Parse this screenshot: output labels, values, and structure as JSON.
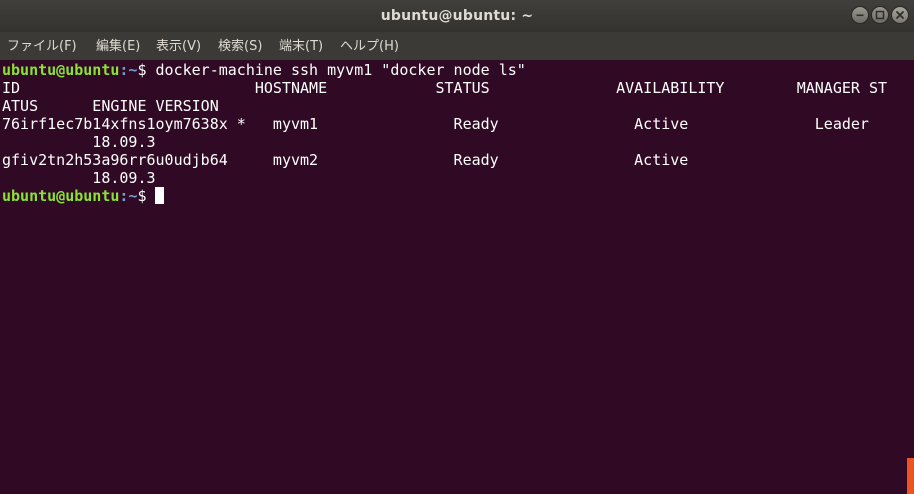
{
  "window": {
    "title": "ubuntu@ubuntu: ~"
  },
  "menu": {
    "file": "ファイル(F)",
    "edit": "編集(E)",
    "view": "表示(V)",
    "search": "検索(S)",
    "terminal": "端末(T)",
    "help": "ヘルプ(H)"
  },
  "terminal": {
    "prompt_user": "ubuntu@ubuntu",
    "prompt_path": ":~",
    "prompt_symbol": "$",
    "command": " docker-machine ssh myvm1 \"docker node ls\"",
    "output_lines": [
      "ID                          HOSTNAME            STATUS              AVAILABILITY        MANAGER ST",
      "ATUS      ENGINE VERSION",
      "76irf1ec7b14xfns1oym7638x *   myvm1               Ready               Active              Leader",
      "          18.09.3",
      "gfiv2tn2h53a96rr6u0udjb64     myvm2               Ready               Active",
      "          18.09.3"
    ]
  },
  "colors": {
    "terminal_background": "#300A24",
    "prompt_user": "#8AE234",
    "prompt_path": "#729FCF",
    "scrollbar_thumb": "#E95420"
  }
}
